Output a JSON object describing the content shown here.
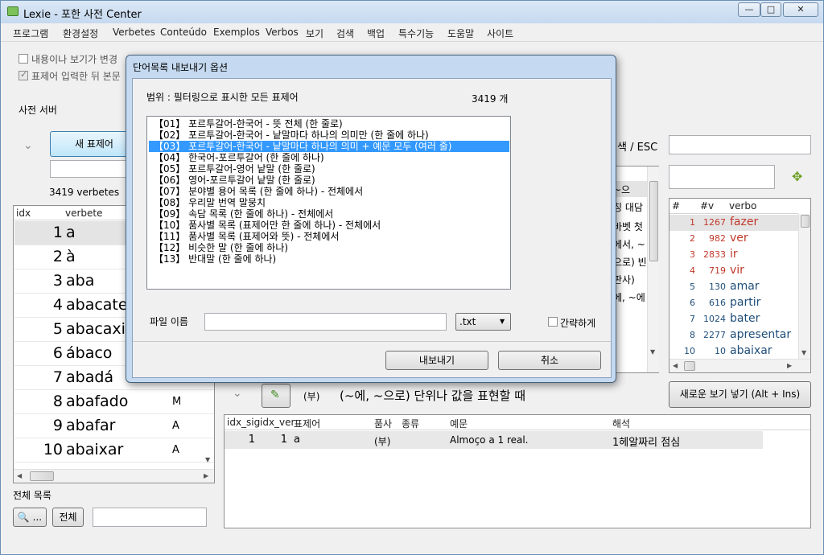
{
  "window": {
    "title": "Lexie - 포한 사전 Center",
    "min_label": "—",
    "max_label": "□",
    "close_label": "✕"
  },
  "menu": [
    "프로그램",
    "환경설정",
    "Verbetes",
    "Conteúdo",
    "Exemplos",
    "Verbos",
    "보기",
    "검색",
    "백업",
    "특수기능",
    "도움말",
    "사이트"
  ],
  "options": {
    "opt1": "내용이나 보기가 변경",
    "opt2": "표제어 입력한 뒤 본문"
  },
  "left": {
    "server_label": "사전 서버",
    "new_entry_button": "새 표제어",
    "verbetes_count": "3419 verbetes",
    "columns": [
      "idx",
      "verbete"
    ],
    "rows": [
      {
        "idx": "1",
        "word": "a",
        "extra": ""
      },
      {
        "idx": "2",
        "word": "à",
        "extra": ""
      },
      {
        "idx": "3",
        "word": "aba",
        "extra": ""
      },
      {
        "idx": "4",
        "word": "abacate",
        "extra": ""
      },
      {
        "idx": "5",
        "word": "abacaxi",
        "extra": ""
      },
      {
        "idx": "6",
        "word": "ábaco",
        "extra": ""
      },
      {
        "idx": "7",
        "word": "abadá",
        "extra": ""
      },
      {
        "idx": "8",
        "word": "abafado",
        "extra": "M"
      },
      {
        "idx": "9",
        "word": "abafar",
        "extra": "A"
      },
      {
        "idx": "10",
        "word": "abaixar",
        "extra": "A"
      }
    ],
    "list_label": "전체 목록",
    "search_button": "🔍 ...",
    "all_button": "전체"
  },
  "right": {
    "search_hint": "색 / ESC",
    "mid_fragments": [
      "~으",
      "칭 대담",
      "바벳 첫",
      "에서, ~",
      "으로) 빈",
      "판사)",
      "에, ~에"
    ],
    "verb_columns": [
      "#",
      "#v",
      "verbo"
    ],
    "verbs": [
      {
        "n": "1",
        "c": "1267",
        "w": "fazer",
        "color": "#c0392b"
      },
      {
        "n": "2",
        "c": "982",
        "w": "ver",
        "color": "#c0392b"
      },
      {
        "n": "3",
        "c": "2833",
        "w": "ir",
        "color": "#c0392b"
      },
      {
        "n": "4",
        "c": "719",
        "w": "vir",
        "color": "#c0392b"
      },
      {
        "n": "5",
        "c": "130",
        "w": "amar",
        "color": "#1f4e79"
      },
      {
        "n": "6",
        "c": "616",
        "w": "partir",
        "color": "#1f4e79"
      },
      {
        "n": "7",
        "c": "1024",
        "w": "bater",
        "color": "#1f4e79"
      },
      {
        "n": "8",
        "c": "2277",
        "w": "apresentar",
        "color": "#1f4e79"
      },
      {
        "n": "10",
        "c": "10",
        "w": "abaixar",
        "color": "#1f4e79"
      }
    ]
  },
  "meaning": {
    "pos_tag": "(부)",
    "text": "(~에, ~으로) 단위나 값을 표현할 때",
    "new_view_button": "새로운 보기 넣기 (Alt + Ins)",
    "columns": [
      "idx_sig",
      "idx_ver",
      "표제어",
      "품사",
      "종류",
      "예문",
      "해석"
    ],
    "row": {
      "sig": "1",
      "ver": "1",
      "word": "a",
      "pos": "(부)",
      "kind": "",
      "example": "Almoço a 1 real.",
      "trans": "1헤알짜리 점심"
    }
  },
  "dialog": {
    "title": "단어목록 내보내기 옵션",
    "scope_label": "범위 : 필터링으로 표시한 모든 표제어",
    "count": "3419 개",
    "items": [
      "【01】 포르투갈어-한국어 - 뜻 전체 (한 줄로)",
      "【02】 포르투갈어-한국어 - 낱말마다 하나의 의미만 (한 줄에 하나)",
      "【03】 포르투갈어-한국어 - 낱말마다 하나의 의미 + 예문 모두 (여러 줄)",
      "【04】 한국어-포르투갈어 (한 줄에 하나)",
      "【05】 포르투갈어-영어 낱말 (한 줄로)",
      "【06】 영어-포르투갈어 낱말 (한 줄로)",
      "【07】 분야별 용어 목록 (한 줄에 하나) - 전체에서",
      "【08】 우리말 번역 말뭉치",
      "【09】 속담 목록 (한 줄에 하나) - 전체에서",
      "【10】 품사별 목록 (표제어만 한 줄에 하나) - 전체에서",
      "【11】 품사별 목록 (표제어와 뜻) - 전체에서",
      "【12】 비슷한 말 (한 줄에 하나)",
      "【13】 반대말 (한 줄에 하나)"
    ],
    "selected_index": 2,
    "filename_label": "파일 이름",
    "filename_value": "",
    "ext_value": ".txt",
    "brief_label": "간략하게",
    "export_button": "내보내기",
    "cancel_button": "취소"
  }
}
